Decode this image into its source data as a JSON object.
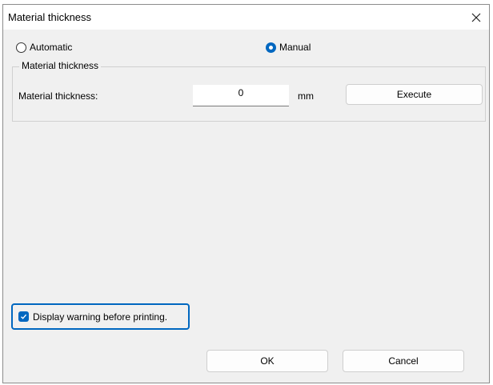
{
  "window": {
    "title": "Material thickness",
    "close_glyph": "✕"
  },
  "mode": {
    "automatic_label": "Automatic",
    "manual_label": "Manual",
    "selected": "Manual"
  },
  "group": {
    "legend": "Material thickness",
    "field_label": "Material thickness:",
    "value": "0",
    "unit": "mm",
    "execute_label": "Execute"
  },
  "warning": {
    "label": "Display warning before printing.",
    "checked": true
  },
  "footer": {
    "ok_label": "OK",
    "cancel_label": "Cancel"
  },
  "colors": {
    "accent": "#0067c0",
    "dialog_bg": "#f0f0f0"
  },
  "icons": {
    "close": "close-icon",
    "check": "checkmark-icon"
  }
}
